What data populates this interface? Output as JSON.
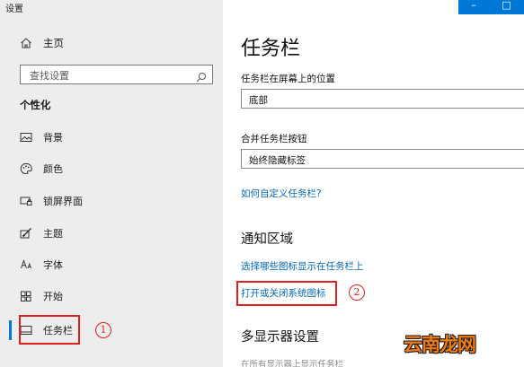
{
  "window": {
    "title": "设置",
    "minimize_glyph": "–",
    "maximize_glyph": "□"
  },
  "sidebar": {
    "home_label": "主页",
    "home_icon": "home-icon",
    "search_placeholder": "查找设置",
    "search_icon": "search-icon",
    "section_title": "个性化",
    "items": [
      {
        "label": "背景",
        "icon": "background-image-icon"
      },
      {
        "label": "颜色",
        "icon": "palette-icon"
      },
      {
        "label": "锁屏界面",
        "icon": "lock-screen-icon"
      },
      {
        "label": "主题",
        "icon": "theme-brush-icon"
      },
      {
        "label": "字体",
        "icon": "font-icon"
      },
      {
        "label": "开始",
        "icon": "start-grid-icon"
      },
      {
        "label": "任务栏",
        "icon": "taskbar-icon",
        "selected": true
      }
    ],
    "accent_color": "#0078d7"
  },
  "main": {
    "title": "任务栏",
    "position_label": "任务栏在屏幕上的位置",
    "position_value": "底部",
    "combine_label": "合并任务栏按钮",
    "combine_value": "始终隐藏标签",
    "customize_link": "如何自定义任务栏?",
    "notify_title": "通知区域",
    "notify_link1": "选择哪些图标显示在任务栏上",
    "notify_link2": "打开或关闭系统图标",
    "multi_title": "多显示器设置",
    "multi_faded": "在所有显示器上显示任务栏",
    "link_color": "#0067b8"
  },
  "annotations": {
    "marker1": "1",
    "marker2": "2",
    "color": "#e0201a"
  },
  "watermark": "云南龙网"
}
